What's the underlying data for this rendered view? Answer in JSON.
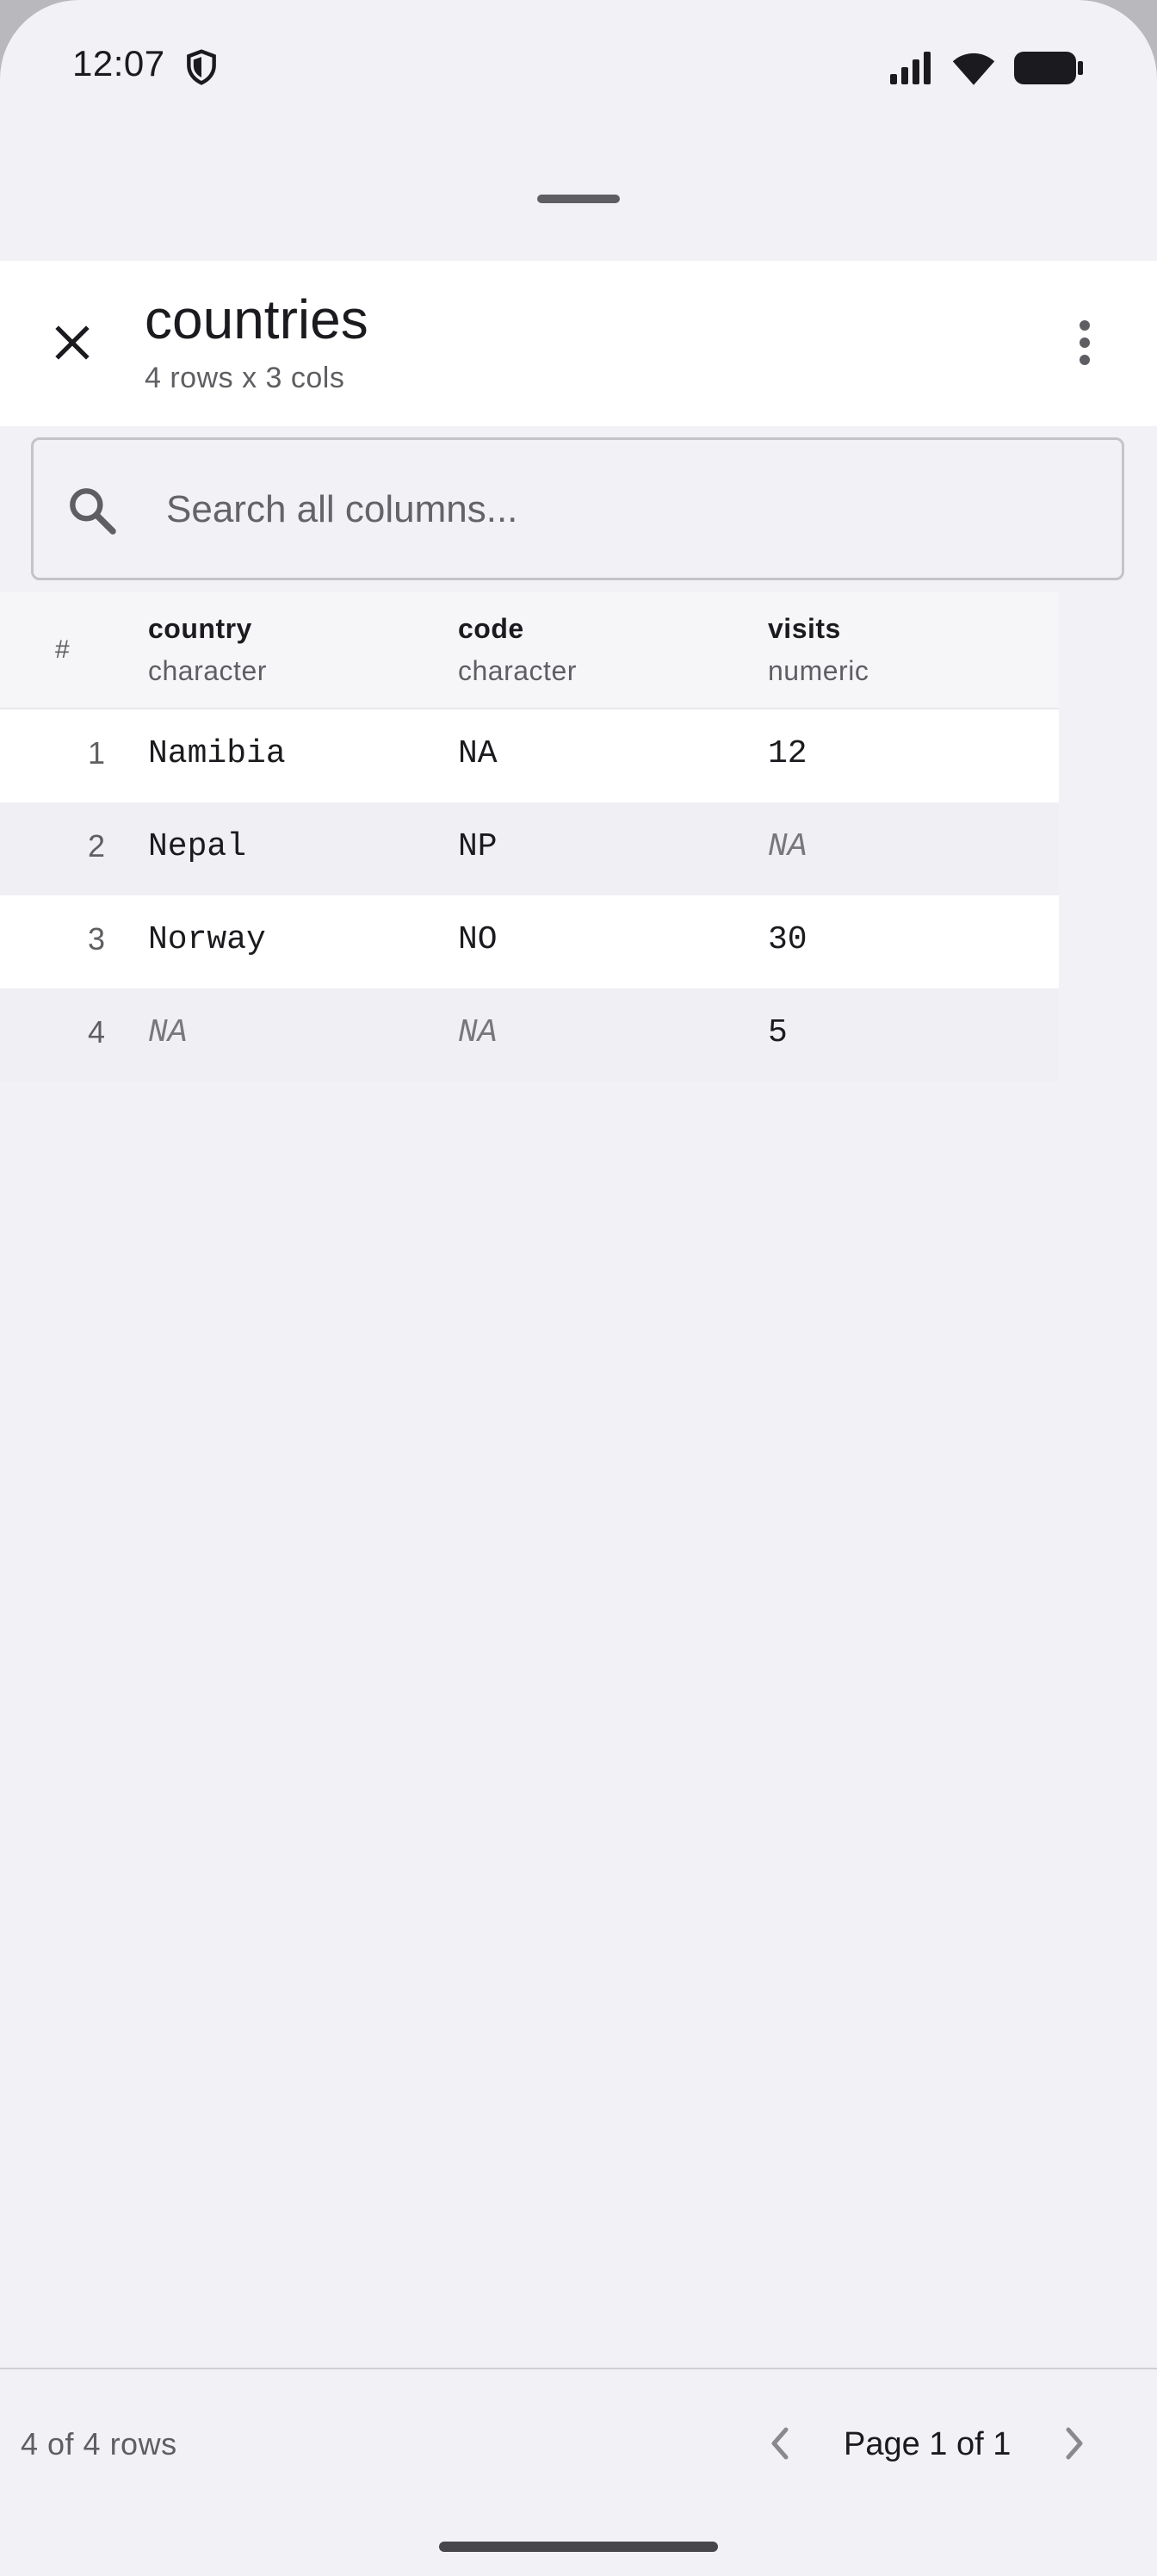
{
  "status_bar": {
    "time": "12:07"
  },
  "header": {
    "title": "countries",
    "subtitle": "4 rows x 3 cols"
  },
  "search": {
    "placeholder": "Search all columns..."
  },
  "table": {
    "index_header": "#",
    "columns": [
      {
        "name": "country",
        "type": "character"
      },
      {
        "name": "code",
        "type": "character"
      },
      {
        "name": "visits",
        "type": "numeric"
      }
    ],
    "rows": [
      {
        "index": "1",
        "cells": [
          "Namibia",
          "NA",
          "12"
        ]
      },
      {
        "index": "2",
        "cells": [
          "Nepal",
          "NP",
          "NA"
        ]
      },
      {
        "index": "3",
        "cells": [
          "Norway",
          "NO",
          "30"
        ]
      },
      {
        "index": "4",
        "cells": [
          "NA",
          "NA",
          "5"
        ]
      }
    ]
  },
  "footer": {
    "row_count": "4 of 4 rows",
    "page_label": "Page 1 of 1"
  },
  "icons": {
    "close": "close-icon",
    "menu": "more-vert-icon",
    "search": "search-icon",
    "prev": "chevron-left-icon",
    "next": "chevron-right-icon"
  }
}
